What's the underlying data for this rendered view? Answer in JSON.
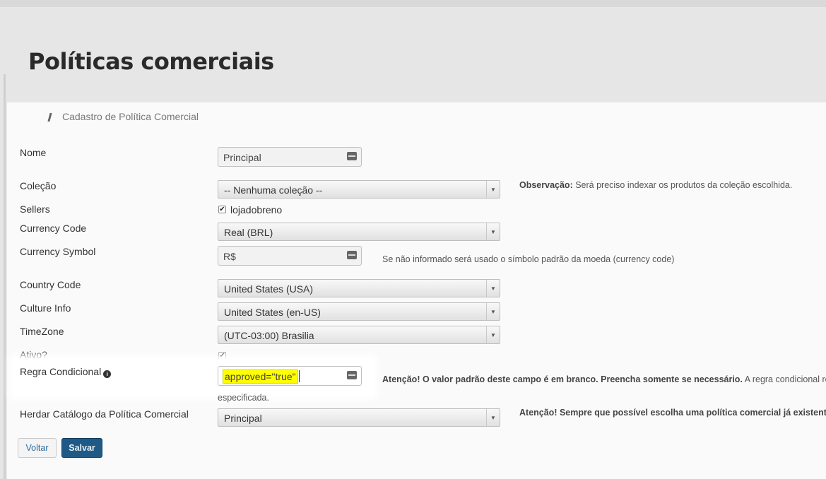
{
  "page": {
    "title": "Políticas comerciais"
  },
  "breadcrumb": {
    "label": "Cadastro de Política Comercial"
  },
  "form": {
    "nome": {
      "label": "Nome",
      "value": "Principal"
    },
    "colecao": {
      "label": "Coleção",
      "value": "-- Nenhuma coleção --",
      "note_bold": "Observação:",
      "note_text": " Será preciso indexar os produtos da coleção escolhida."
    },
    "sellers": {
      "label": "Sellers",
      "option": "lojadobreno",
      "checked": true
    },
    "currency_code": {
      "label": "Currency Code",
      "value": "Real (BRL)"
    },
    "currency_symbol": {
      "label": "Currency Symbol",
      "value": "R$",
      "note": "Se não informado será usado o símbolo padrão da moeda (currency code)"
    },
    "country_code": {
      "label": "Country Code",
      "value": "United States (USA)"
    },
    "culture_info": {
      "label": "Culture Info",
      "value": "United States (en-US)"
    },
    "timezone": {
      "label": "TimeZone",
      "value": "(UTC-03:00) Brasilia"
    },
    "ativo": {
      "label": "Ativo?",
      "checked": true
    },
    "regra_condicional": {
      "label": "Regra Condicional",
      "value": "approved=\"true\"",
      "note_bold": "Atenção! O valor padrão deste campo é em branco. Preencha somente se necessário.",
      "note_text": " A regra condicional red",
      "note_cont": "especificada."
    },
    "herdar_catalogo": {
      "label": "Herdar Catálogo da Política Comercial",
      "value": "Principal",
      "note_bold": "Atenção! Sempre que possível escolha uma política comercial já existente p"
    }
  },
  "buttons": {
    "back": "Voltar",
    "save": "Salvar"
  },
  "icons": {
    "keyboard": "keyboard-icon",
    "dropdown": "chevron-down-icon",
    "info": "info-icon",
    "checkmark": "✔"
  },
  "colors": {
    "highlight": "#ffff00",
    "save_button": "#1f5a86",
    "link": "#2a6aa0"
  }
}
